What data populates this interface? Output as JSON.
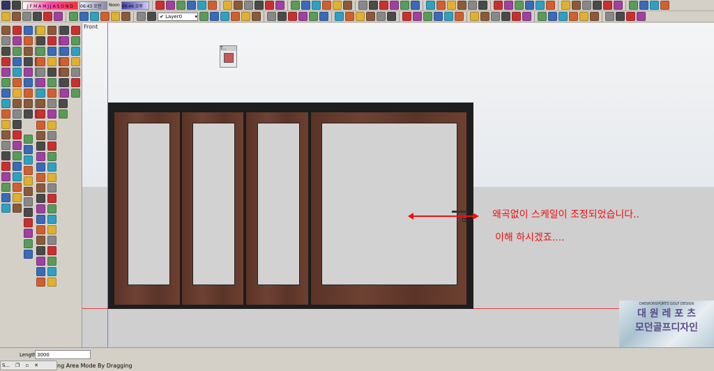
{
  "toolbar": {
    "months": "J F M A M J J A S O N D",
    "time1": "06:43 오전",
    "noon": "Noon",
    "time2": "04:46 오후",
    "layer": "Layer0"
  },
  "viewport": {
    "view_label": "Front",
    "float_title": "T..."
  },
  "annotation": {
    "line1": "왜곡없이 스케일이 조정되었습니다..",
    "line2": "이해 하시겠죠...."
  },
  "watermark": {
    "title1": "대 원 레 포 츠",
    "title2": "모던골프디자인",
    "tagline": "DAEWONSPORTS GOLF DESIGN"
  },
  "status": {
    "length_label": "Length",
    "length_value": "3000",
    "tab_label": "S...",
    "message": "ng Area Mode By Dragging"
  },
  "colors": {
    "accent": "#f01010",
    "axis_green": "#3cb43c",
    "axis_red": "#e04040"
  }
}
